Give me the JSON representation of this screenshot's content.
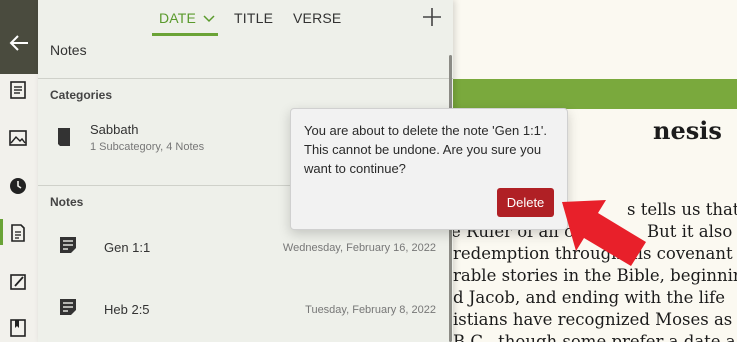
{
  "tabs": [
    {
      "label": "DATE",
      "active": true
    },
    {
      "label": "TITLE",
      "active": false
    },
    {
      "label": "VERSE",
      "active": false
    }
  ],
  "panel_title": "Notes",
  "categories_header": "Categories",
  "category": {
    "name": "Sabbath",
    "detail": "1 Subcategory, 4 Notes"
  },
  "notes_header": "Notes",
  "notes": [
    {
      "label": "Gen 1:1",
      "date": "Wednesday, February 16, 2022"
    },
    {
      "label": "Heb 2:5",
      "date": "Tuesday, February 8, 2022"
    }
  ],
  "dialog": {
    "message": "You are about to delete the note 'Gen 1:1'. This cannot be undone. Are you sure you want to continue?",
    "delete_label": "Delete"
  },
  "reader": {
    "heading": "nesis",
    "lines": [
      "s tells us that G",
      "e Ruler of all cr",
      "But it also",
      "redemption through his covenant",
      "rable stories in the Bible, beginnin",
      "d Jacob, and ending with the life",
      "istians have recognized Moses as",
      "B.C., though some prefer a date a"
    ]
  },
  "colors": {
    "accent": "#6aa336",
    "danger": "#b02025",
    "arrow": "#e8202a"
  }
}
